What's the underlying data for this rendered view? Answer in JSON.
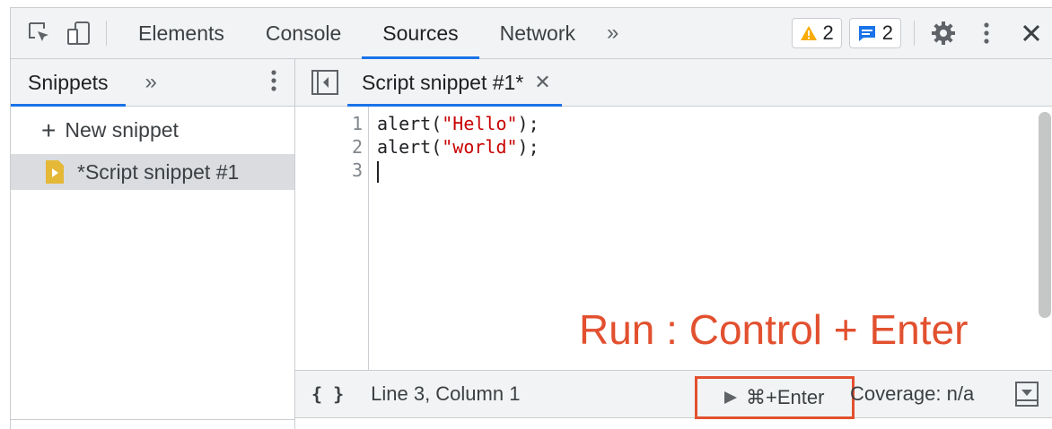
{
  "toolbar": {
    "tabs": [
      "Elements",
      "Console",
      "Sources",
      "Network"
    ],
    "active_tab": "Sources",
    "warnings_count": "2",
    "messages_count": "2"
  },
  "sidebar": {
    "tab_label": "Snippets",
    "new_snippet_label": "New snippet",
    "snippet_name": "*Script snippet #1"
  },
  "editor": {
    "file_tab_label": "Script snippet #1*",
    "line_numbers": [
      "1",
      "2",
      "3"
    ],
    "code": {
      "l1_fn": "alert(",
      "l1_str": "\"Hello\"",
      "l1_end": ");",
      "l2_fn": "alert(",
      "l2_str": "\"world\"",
      "l2_end": ");"
    }
  },
  "status": {
    "pretty_print": "{ }",
    "position": "Line 3, Column 1",
    "run_shortcut": "⌘+Enter",
    "coverage": "Coverage: n/a"
  },
  "annotation": "Run : Control + Enter",
  "colors": {
    "accent": "#1a73e8",
    "annotation": "#e2502f",
    "string": "#c80000",
    "warning": "#f9ab00"
  }
}
